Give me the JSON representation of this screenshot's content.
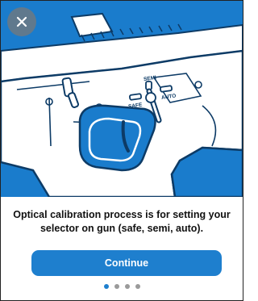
{
  "hero": {
    "image": "rifle-selector-illustration",
    "selector_labels": {
      "safe": "SAFE",
      "semi": "SEMI",
      "auto": "AUTO"
    }
  },
  "close_icon": "close-icon",
  "message": "Optical calibration process is for setting your selector on gun (safe, semi, auto).",
  "continue_label": "Continue",
  "pagination": {
    "total": 4,
    "active_index": 0
  },
  "colors": {
    "accent": "#1e7fce",
    "illustration_blue": "#1a7ccc",
    "line": "#0d3b66"
  }
}
